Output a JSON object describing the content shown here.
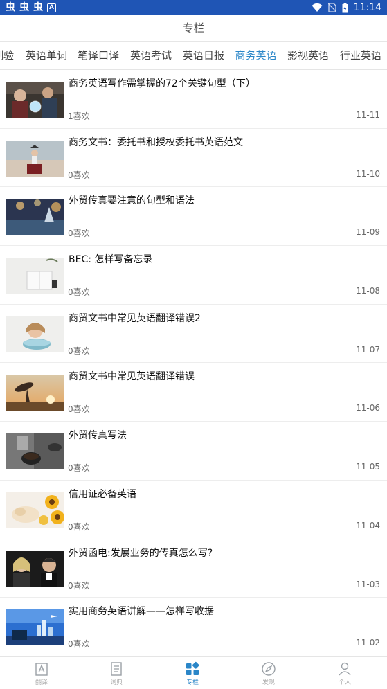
{
  "status_bar": {
    "app_icons": [
      "虫",
      "虫",
      "虫"
    ],
    "a_badge": "A",
    "time": "11:14"
  },
  "header": {
    "title": "专栏"
  },
  "tabs": [
    {
      "label": "测验"
    },
    {
      "label": "英语单词"
    },
    {
      "label": "笔译口译"
    },
    {
      "label": "英语考试"
    },
    {
      "label": "英语日报"
    },
    {
      "label": "商务英语",
      "active": true
    },
    {
      "label": "影视英语"
    },
    {
      "label": "行业英语"
    }
  ],
  "articles": [
    {
      "title": "商务英语写作需掌握的72个关键句型（下）",
      "likes": "1喜欢",
      "date": "11-11",
      "thumb": "children-crystal-ball"
    },
    {
      "title": "商务文书：委托书和授权委托书英语范文",
      "likes": "0喜欢",
      "date": "11-10",
      "thumb": "child-on-suitcase"
    },
    {
      "title": "外贸传真要注意的句型和语法",
      "likes": "0喜欢",
      "date": "11-09",
      "thumb": "christmas-tree-bokeh"
    },
    {
      "title": "BEC: 怎样写备忘录",
      "likes": "0喜欢",
      "date": "11-08",
      "thumb": "notebook-desk"
    },
    {
      "title": "商贸文书中常见英语翻译错误2",
      "likes": "0喜欢",
      "date": "11-07",
      "thumb": "girl-with-bowl"
    },
    {
      "title": "商贸文书中常见英语翻译错误",
      "likes": "0喜欢",
      "date": "11-06",
      "thumb": "sunset-silhouette"
    },
    {
      "title": "外贸传真写法",
      "likes": "0喜欢",
      "date": "11-05",
      "thumb": "coffee-cups"
    },
    {
      "title": "信用证必备英语",
      "likes": "0喜欢",
      "date": "11-04",
      "thumb": "puppy-sunflowers"
    },
    {
      "title": "外贸函电:发展业务的传真怎么写?",
      "likes": "0喜欢",
      "date": "11-03",
      "thumb": "two-people-portrait"
    },
    {
      "title": "实用商务英语讲解——怎样写收据",
      "likes": "0喜欢",
      "date": "11-02",
      "thumb": "city-skyline"
    }
  ],
  "bottom_nav": [
    {
      "label": "翻译",
      "icon": "translate-icon"
    },
    {
      "label": "词典",
      "icon": "dictionary-icon"
    },
    {
      "label": "专栏",
      "icon": "column-icon",
      "active": true
    },
    {
      "label": "发现",
      "icon": "compass-icon"
    },
    {
      "label": "个人",
      "icon": "person-icon"
    }
  ],
  "colors": {
    "accent": "#2a86c8",
    "status_bar": "#1f55b5"
  }
}
